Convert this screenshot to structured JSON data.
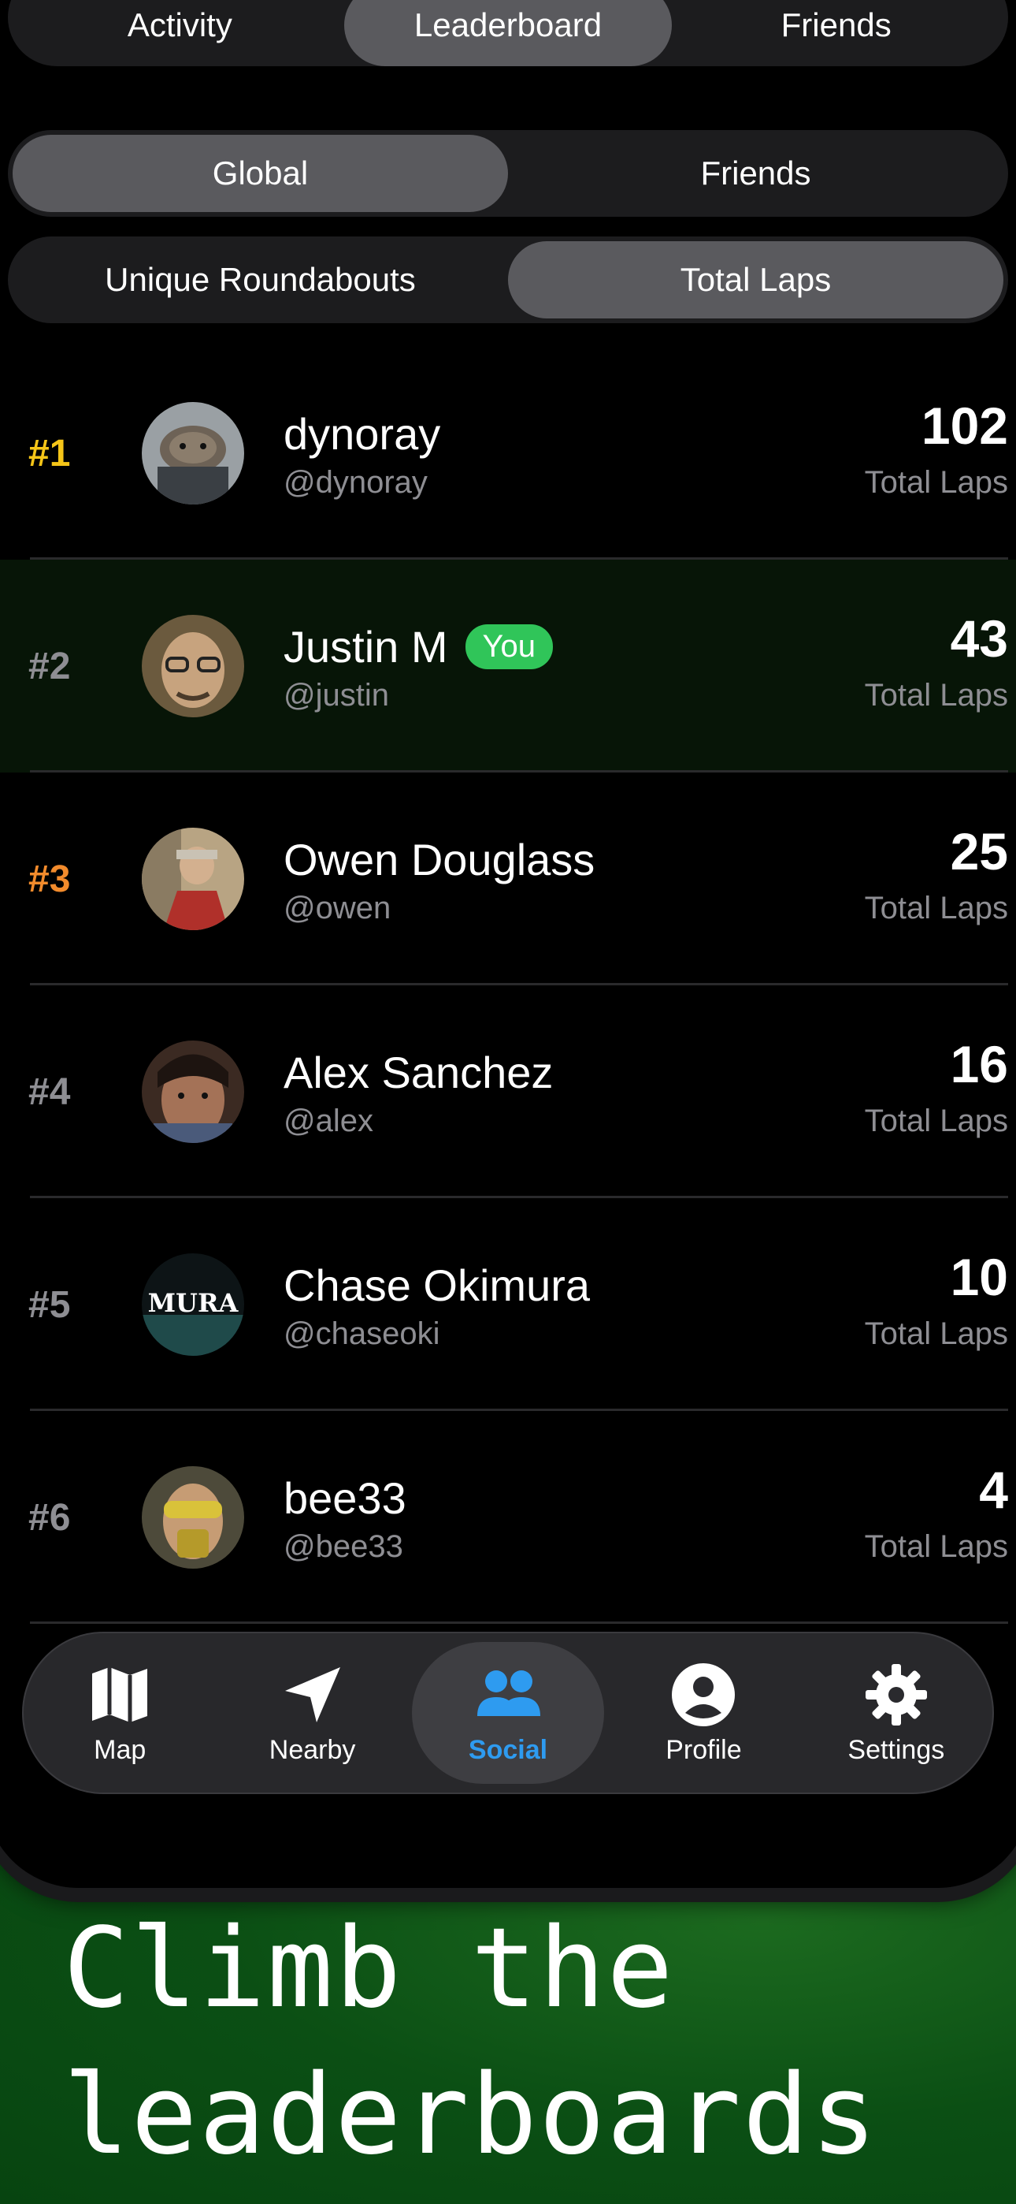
{
  "top_tabs": [
    "Activity",
    "Leaderboard",
    "Friends"
  ],
  "scope_tabs": [
    "Global",
    "Friends"
  ],
  "metric_tabs": [
    "Unique Roundabouts",
    "Total Laps"
  ],
  "colors": {
    "gold": "#f5c518",
    "bronze": "#f28b2c",
    "rank_default": "#8e8e93",
    "you_badge": "#30c559",
    "accent": "#2e9bf0"
  },
  "rows": [
    {
      "rank": "#1",
      "name": "dynoray",
      "handle": "@dynoray",
      "value": "102",
      "unit": "Total Laps"
    },
    {
      "rank": "#2",
      "name": "Justin M",
      "badge": "You",
      "handle": "@justin",
      "value": "43",
      "unit": "Total Laps"
    },
    {
      "rank": "#3",
      "name": "Owen Douglass",
      "handle": "@owen",
      "value": "25",
      "unit": "Total Laps"
    },
    {
      "rank": "#4",
      "name": "Alex Sanchez",
      "handle": "@alex",
      "value": "16",
      "unit": "Total Laps"
    },
    {
      "rank": "#5",
      "name": "Chase Okimura",
      "handle": "@chaseoki",
      "value": "10",
      "unit": "Total Laps",
      "avatar_text": "MURA"
    },
    {
      "rank": "#6",
      "name": "bee33",
      "handle": "@bee33",
      "value": "4",
      "unit": "Total Laps"
    }
  ],
  "tabbar": [
    {
      "label": "Map",
      "icon": "map-icon"
    },
    {
      "label": "Nearby",
      "icon": "location-arrow-icon"
    },
    {
      "label": "Social",
      "icon": "people-icon"
    },
    {
      "label": "Profile",
      "icon": "person-circle-icon"
    },
    {
      "label": "Settings",
      "icon": "gear-icon"
    }
  ],
  "headline": [
    "Climb the",
    "leaderboards"
  ]
}
